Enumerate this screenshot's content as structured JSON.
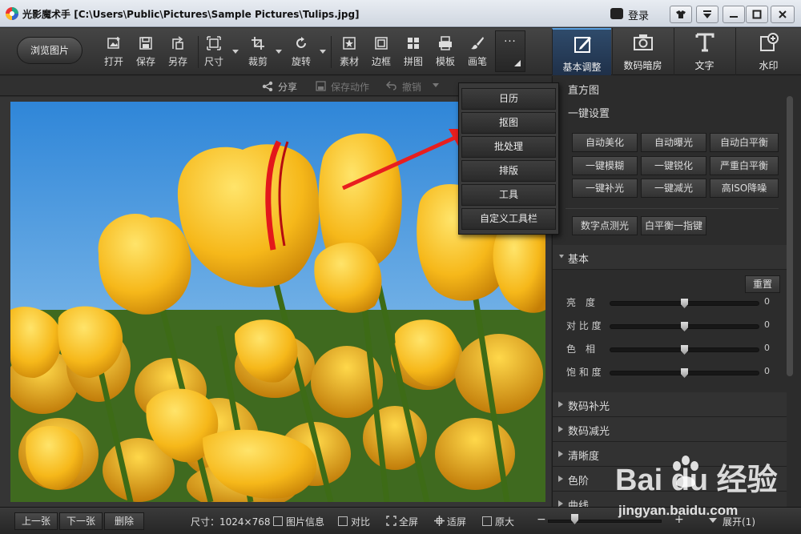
{
  "window": {
    "app_name": "光影魔术手",
    "file_path": "[C:\\Users\\Public\\Pictures\\Sample Pictures\\Tulips.jpg]",
    "login_label": "登录",
    "controls": [
      "▾",
      "▾",
      "—",
      "□",
      "✕"
    ]
  },
  "toolbar": {
    "browse_label": "浏览图片",
    "tools": [
      {
        "label": "打开",
        "icon": "open-image-icon"
      },
      {
        "label": "保存",
        "icon": "save-icon"
      },
      {
        "label": "另存",
        "icon": "save-as-icon"
      },
      {
        "label": "尺寸",
        "icon": "resize-icon"
      },
      {
        "label": "裁剪",
        "icon": "crop-icon"
      },
      {
        "label": "旋转",
        "icon": "rotate-icon"
      },
      {
        "label": "素材",
        "icon": "material-icon"
      },
      {
        "label": "边框",
        "icon": "border-icon"
      },
      {
        "label": "拼图",
        "icon": "collage-icon"
      },
      {
        "label": "模板",
        "icon": "template-icon"
      },
      {
        "label": "画笔",
        "icon": "brush-icon"
      }
    ],
    "more_label": "···",
    "right_tabs": [
      {
        "label": "基本调整",
        "icon": "basic-adjust-icon"
      },
      {
        "label": "数码暗房",
        "icon": "darkroom-icon"
      },
      {
        "label": "文字",
        "icon": "text-icon"
      },
      {
        "label": "水印",
        "icon": "watermark-icon"
      }
    ]
  },
  "subbar": {
    "share_label": "分享",
    "save_action_label": "保存动作",
    "undo_label": "撤销"
  },
  "more_menu": {
    "items": [
      "日历",
      "抠图",
      "批处理",
      "排版",
      "工具",
      "自定义工具栏"
    ]
  },
  "panel": {
    "histogram_label": "直方图",
    "oneclick_label": "一键设置",
    "oneclick_buttons": [
      "自动美化",
      "自动曝光",
      "自动白平衡",
      "一键模糊",
      "一键锐化",
      "严重白平衡",
      "一键补光",
      "一键减光",
      "高ISO降噪"
    ],
    "extra_buttons": [
      "数字点测光",
      "白平衡一指键"
    ],
    "basic_label": "基本",
    "reset_label": "重置",
    "sliders": [
      {
        "label": "亮　度",
        "value": "0"
      },
      {
        "label": "对 比 度",
        "value": "0"
      },
      {
        "label": "色　相",
        "value": "0"
      },
      {
        "label": "饱 和 度",
        "value": "0"
      }
    ],
    "sections": [
      "数码补光",
      "数码减光",
      "清晰度",
      "色阶",
      "曲线"
    ]
  },
  "bottombar": {
    "prev_label": "上一张",
    "next_label": "下一张",
    "delete_label": "删除",
    "size_text": "尺寸：1024×768",
    "info_label": "图片信息",
    "compare_label": "对比",
    "fullscreen_label": "全屏",
    "fit_label": "适屏",
    "original_label": "原大",
    "expand_label": "展开(1)"
  },
  "watermark": {
    "logo_text": "Bai du 经验",
    "url": "jingyan.baidu.com"
  }
}
